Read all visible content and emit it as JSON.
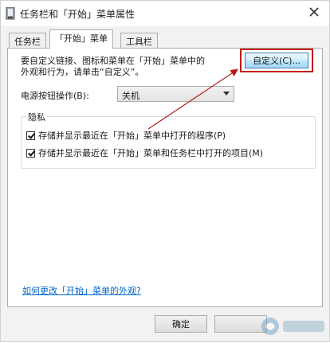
{
  "window": {
    "title": "任务栏和「开始」菜单属性"
  },
  "tabs": [
    {
      "label": "任务栏"
    },
    {
      "label": "「开始」菜单"
    },
    {
      "label": "工具栏"
    }
  ],
  "start_menu_tab": {
    "description_line1": "要自定义链接、图标和菜单在「开始」菜单中的",
    "description_line2": "外观和行为，请单击“自定义”。",
    "customize_button_label": "自定义(C)...",
    "power_button_label": "电源按钮操作(B):",
    "power_button_value": "关机",
    "privacy": {
      "label": "隐私",
      "options": [
        {
          "label": "存储并显示最近在「开始」菜单中打开的程序(P)",
          "checked": true
        },
        {
          "label": "存储并显示最近在「开始」菜单和任务栏中打开的项目(M)",
          "checked": true
        }
      ]
    },
    "help_link": "如何更改「开始」菜单的外观?"
  },
  "footer": {
    "ok_label": "确定"
  },
  "annotation": {
    "highlight_color": "#c21b1b"
  }
}
